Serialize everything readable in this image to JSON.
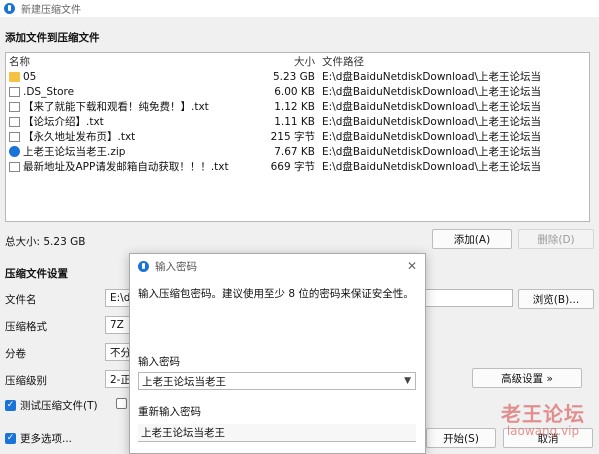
{
  "window": {
    "title": "新建压缩文件"
  },
  "add_section": {
    "title": "添加文件到压缩文件"
  },
  "file_list": {
    "columns": {
      "name": "名称",
      "size": "大小",
      "path": "文件路径"
    },
    "rows": [
      {
        "icon": "folder-icon",
        "name": "05",
        "size": "5.23 GB",
        "path": "E:\\d盘BaiduNetdiskDownload\\上老王论坛当"
      },
      {
        "icon": "file-icon",
        "name": ".DS_Store",
        "size": "6.00 KB",
        "path": "E:\\d盘BaiduNetdiskDownload\\上老王论坛当"
      },
      {
        "icon": "file-icon",
        "name": "【来了就能下载和观看！纯免费！】.txt",
        "size": "1.12 KB",
        "path": "E:\\d盘BaiduNetdiskDownload\\上老王论坛当"
      },
      {
        "icon": "file-icon",
        "name": "【论坛介绍】.txt",
        "size": "1.11 KB",
        "path": "E:\\d盘BaiduNetdiskDownload\\上老王论坛当"
      },
      {
        "icon": "file-icon",
        "name": "【永久地址发布页】.txt",
        "size": "215 字节",
        "path": "E:\\d盘BaiduNetdiskDownload\\上老王论坛当"
      },
      {
        "icon": "zip-icon",
        "name": "上老王论坛当老王.zip",
        "size": "7.67 KB",
        "path": "E:\\d盘BaiduNetdiskDownload\\上老王论坛当"
      },
      {
        "icon": "file-icon",
        "name": "最新地址及APP请发邮箱自动获取！！！.txt",
        "size": "669 字节",
        "path": "E:\\d盘BaiduNetdiskDownload\\上老王论坛当"
      }
    ]
  },
  "summary": {
    "total": "总大小: 5.23 GB"
  },
  "buttons": {
    "add": "添加(A)",
    "delete": "删除(D)",
    "browse": "浏览(B)...",
    "advanced": "高级设置 »",
    "start": "开始(S)",
    "cancel": "取消"
  },
  "settings": {
    "title": "压缩文件设置",
    "filename_label": "文件名",
    "filename_value": "E:\\d",
    "format_label": "压缩格式",
    "format_value": "7Z",
    "split_label": "分卷",
    "split_value": "不分",
    "level_label": "压缩级别",
    "level_value": "2-正",
    "test_label": "测试压缩文件(T)",
    "more_label": "更多选项..."
  },
  "password_dialog": {
    "title": "输入密码",
    "description": "输入压缩包密码。建议使用至少 8 位的密码来保证安全性。",
    "password_label": "输入密码",
    "password_value": "上老王论坛当老王",
    "confirm_label": "重新输入密码",
    "confirm_value": "上老王论坛当老王"
  },
  "watermark": {
    "line1": "老王论坛",
    "line2": "laowang.vip"
  },
  "colors": {
    "accent": "#1a73d9",
    "folder": "#f5c243",
    "watermark": "#d95a5a"
  }
}
